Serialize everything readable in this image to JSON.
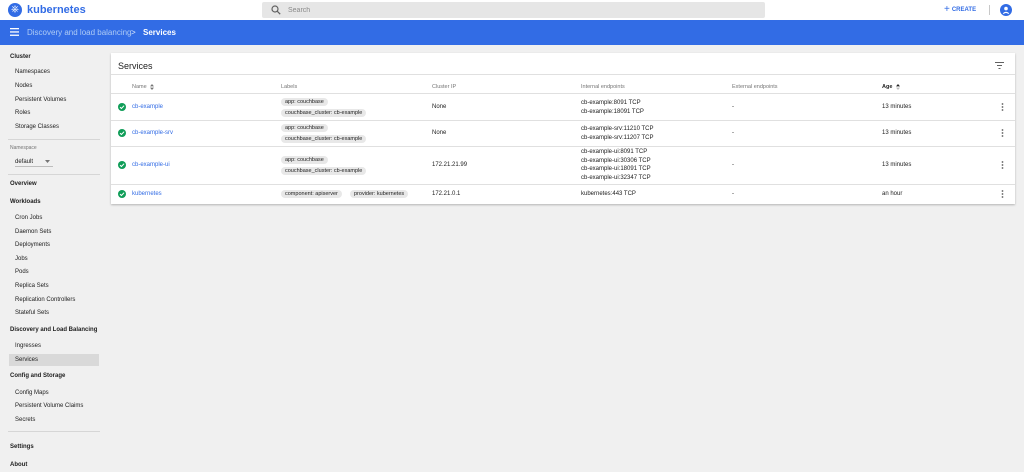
{
  "topbar": {
    "brand": "kubernetes",
    "search_placeholder": "Search",
    "create_label": "CREATE"
  },
  "header": {
    "breadcrumb_parent": "Discovery and load balancing",
    "breadcrumb_sep": ">",
    "breadcrumb_current": "Services"
  },
  "sidebar": {
    "cluster": "Cluster",
    "cluster_items": [
      "Namespaces",
      "Nodes",
      "Persistent Volumes",
      "Roles",
      "Storage Classes"
    ],
    "namespace_label": "Namespace",
    "namespace_value": "default",
    "overview": "Overview",
    "workloads": "Workloads",
    "workload_items": [
      "Cron Jobs",
      "Daemon Sets",
      "Deployments",
      "Jobs",
      "Pods",
      "Replica Sets",
      "Replication Controllers",
      "Stateful Sets"
    ],
    "discovery": "Discovery and Load Balancing",
    "discovery_items": [
      "Ingresses",
      "Services"
    ],
    "config": "Config and Storage",
    "config_items": [
      "Config Maps",
      "Persistent Volume Claims",
      "Secrets"
    ],
    "settings": "Settings",
    "about": "About"
  },
  "services": {
    "title": "Services",
    "columns": {
      "name": "Name",
      "labels": "Labels",
      "cluster_ip": "Cluster IP",
      "internal_endpoints": "Internal endpoints",
      "external_endpoints": "External endpoints",
      "age": "Age"
    },
    "rows": [
      {
        "name": "cb-example",
        "labels": [
          "app: couchbase",
          "couchbase_cluster: cb-example"
        ],
        "cluster_ip": "None",
        "internal": [
          "cb-example:8091 TCP",
          "cb-example:18091 TCP"
        ],
        "external": "-",
        "age": "13 minutes"
      },
      {
        "name": "cb-example-srv",
        "labels": [
          "app: couchbase",
          "couchbase_cluster: cb-example"
        ],
        "cluster_ip": "None",
        "internal": [
          "cb-example-srv:11210 TCP",
          "cb-example-srv:11207 TCP"
        ],
        "external": "-",
        "age": "13 minutes"
      },
      {
        "name": "cb-example-ui",
        "labels": [
          "app: couchbase",
          "couchbase_cluster: cb-example"
        ],
        "cluster_ip": "172.21.21.99",
        "internal": [
          "cb-example-ui:8091 TCP",
          "cb-example-ui:30306 TCP",
          "cb-example-ui:18091 TCP",
          "cb-example-ui:32347 TCP"
        ],
        "external": "-",
        "age": "13 minutes"
      },
      {
        "name": "kubernetes",
        "labels": [
          "component: apiserver",
          "provider: kubernetes"
        ],
        "cluster_ip": "172.21.0.1",
        "internal": [
          "kubernetes:443 TCP"
        ],
        "external": "-",
        "age": "an hour"
      }
    ]
  },
  "colors": {
    "brand": "#326ce5",
    "success": "#0f9d58"
  }
}
